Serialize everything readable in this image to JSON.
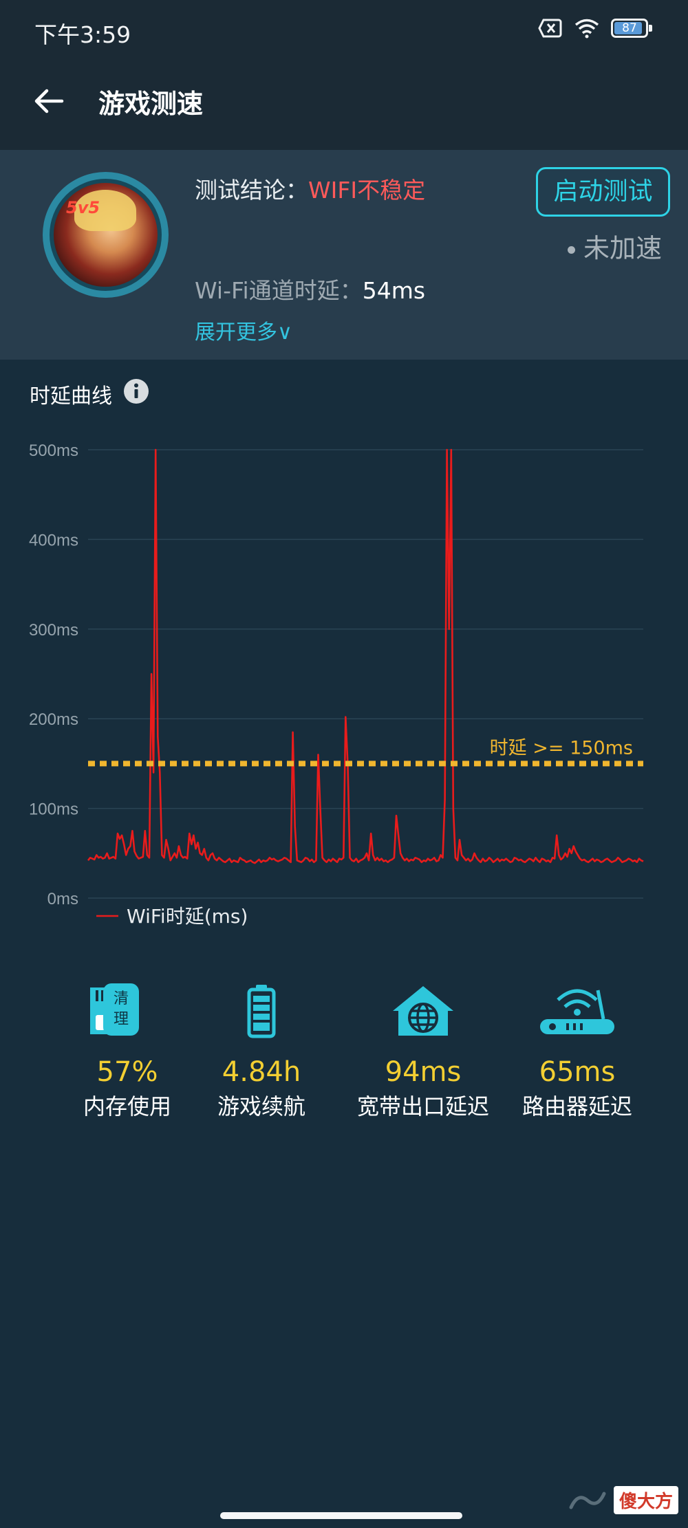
{
  "status_bar": {
    "time": "下午3:59",
    "battery": "87"
  },
  "header": {
    "title": "游戏测速"
  },
  "summary": {
    "conclusion_label": "测试结论：",
    "conclusion_value": "WIFI不稳定",
    "start_button": "启动测试",
    "accel_status": "未加速",
    "latency_label": "Wi-Fi通道时延：",
    "latency_value": "54ms",
    "expand_more": "展开更多∨"
  },
  "curve": {
    "title": "时延曲线"
  },
  "chart_data": {
    "type": "line",
    "ylim": [
      0,
      500
    ],
    "yticks": [
      "0ms",
      "100ms",
      "200ms",
      "300ms",
      "400ms",
      "500ms"
    ],
    "threshold": {
      "label": "时延 >= 150ms",
      "value": 150,
      "color": "#f0b62f"
    },
    "legend": [
      "WiFi时延(ms)"
    ],
    "legend_position": "bottom-left",
    "grid": true,
    "series": [
      {
        "name": "WiFi时延(ms)",
        "color": "#e81c1c",
        "values": [
          42,
          45,
          44,
          43,
          48,
          45,
          46,
          44,
          45,
          50,
          44,
          45,
          46,
          44,
          72,
          66,
          70,
          60,
          48,
          55,
          58,
          75,
          52,
          47,
          44,
          45,
          46,
          75,
          48,
          45,
          250,
          140,
          500,
          180,
          140,
          48,
          45,
          65,
          55,
          42,
          46,
          50,
          45,
          58,
          48,
          45,
          46,
          44,
          72,
          60,
          70,
          55,
          62,
          50,
          48,
          55,
          45,
          42,
          48,
          50,
          44,
          42,
          45,
          43,
          41,
          40,
          42,
          44,
          40,
          42,
          41,
          40,
          45,
          43,
          42,
          40,
          41,
          42,
          40,
          39,
          41,
          43,
          40,
          42,
          41,
          42,
          45,
          43,
          44,
          42,
          41,
          42,
          43,
          45,
          44,
          42,
          40,
          185,
          80,
          42,
          41,
          40,
          42,
          45,
          44,
          41,
          43,
          40,
          42,
          160,
          100,
          45,
          42,
          40,
          43,
          41,
          44,
          42,
          40,
          44,
          43,
          45,
          202,
          150,
          45,
          42,
          41,
          44,
          40,
          42,
          43,
          45,
          50,
          42,
          72,
          48,
          42,
          45,
          42,
          44,
          41,
          42,
          40,
          42,
          43,
          45,
          92,
          70,
          50,
          45,
          42,
          44,
          41,
          43,
          42,
          45,
          44,
          43,
          40,
          42,
          41,
          44,
          42,
          43,
          45,
          41,
          42,
          48,
          45,
          110,
          500,
          300,
          500,
          100,
          45,
          42,
          65,
          48,
          45,
          42,
          44,
          41,
          43,
          50,
          45,
          42,
          40,
          44,
          41,
          42,
          45,
          43,
          40,
          42,
          44,
          41,
          43,
          42,
          44,
          42,
          40,
          41,
          45,
          44,
          42,
          43,
          41,
          40,
          42,
          44,
          43,
          41,
          45,
          42,
          40,
          44,
          43,
          41,
          42,
          40,
          45,
          44,
          70,
          48,
          43,
          45,
          50,
          46,
          55,
          50,
          58,
          52,
          48,
          44,
          42,
          43,
          41,
          40,
          42,
          44,
          41,
          43,
          42,
          40,
          41,
          43,
          44,
          42,
          40,
          41,
          42,
          45,
          43,
          40,
          41,
          42,
          44,
          43,
          41,
          42,
          40,
          44,
          42,
          41
        ]
      }
    ]
  },
  "stats": [
    {
      "value": "57%",
      "label": "内存使用",
      "icon": "sd-card-icon",
      "badge": "清\n理"
    },
    {
      "value": "4.84h",
      "label": "游戏续航",
      "icon": "battery-icon"
    },
    {
      "value": "94ms",
      "label": "宽带出口延迟",
      "icon": "home-globe-icon"
    },
    {
      "value": "65ms",
      "label": "路由器延迟",
      "icon": "router-icon"
    }
  ],
  "watermark": {
    "text": "傻大方"
  },
  "colors": {
    "accent": "#2ed3e6",
    "warning": "#ff5a5a",
    "stat_value": "#f3cf32",
    "series": "#e81c1c"
  }
}
